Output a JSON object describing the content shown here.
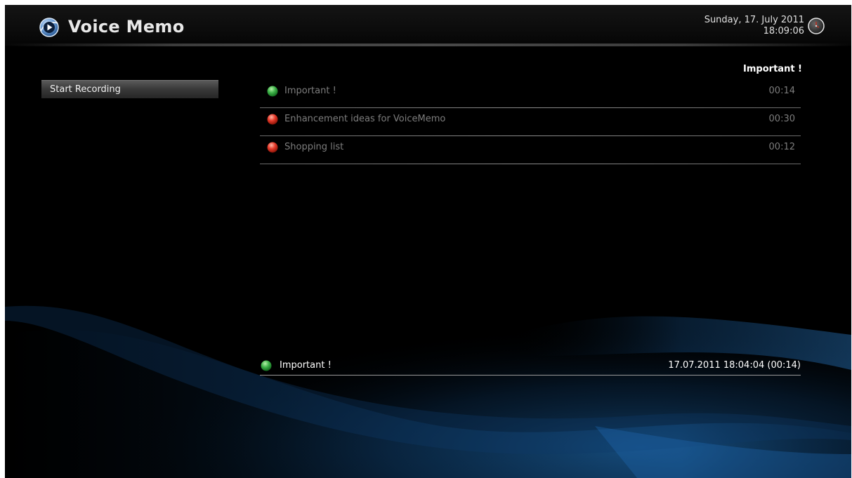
{
  "app": {
    "title": "Voice Memo",
    "icon": "voice-memo-logo-icon"
  },
  "header": {
    "date": "Sunday, 17. July 2011",
    "time": "18:09:06",
    "clock_icon": "clock-icon"
  },
  "menu": {
    "start_recording_label": "Start Recording"
  },
  "list": {
    "heading": "Important !",
    "items": [
      {
        "label": "Important !",
        "duration": "00:14",
        "status": "green",
        "color": "#3fb34a"
      },
      {
        "label": "Enhancement ideas for VoiceMemo",
        "duration": "00:30",
        "status": "red",
        "color": "#e53a2a"
      },
      {
        "label": "Shopping list",
        "duration": "00:12",
        "status": "red",
        "color": "#e53a2a"
      }
    ]
  },
  "detail": {
    "label": "Important !",
    "info": "17.07.2011 18:04:04 (00:14)",
    "status": "green",
    "color": "#3fb34a"
  },
  "colors": {
    "background": "#000000",
    "accent_blue": "#1f5f9f",
    "status_green": "#3fb34a",
    "status_red": "#e53a2a"
  }
}
